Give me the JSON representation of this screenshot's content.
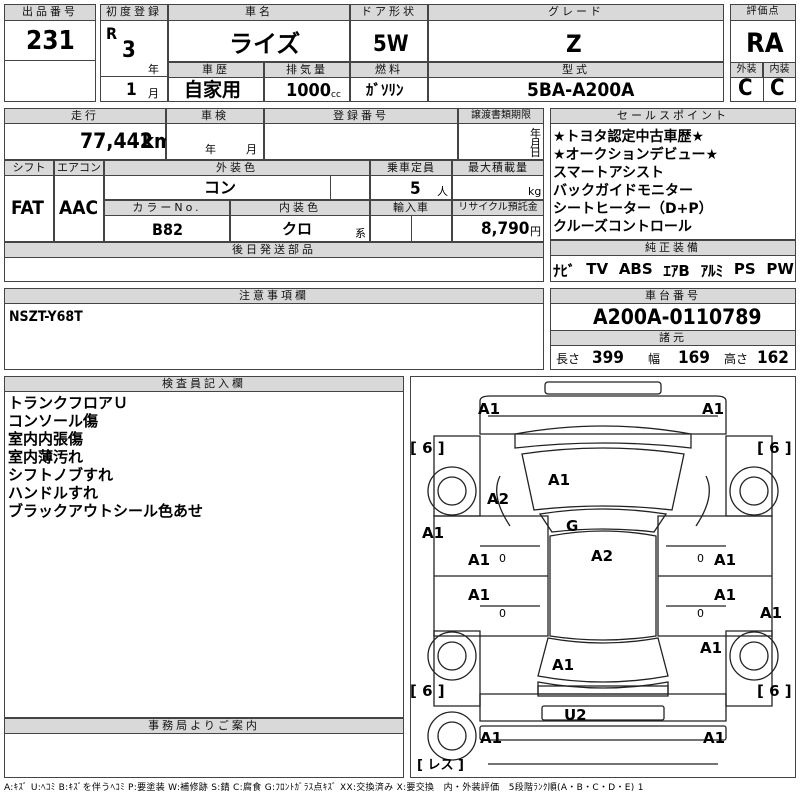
{
  "lot": {
    "header": "出品番号",
    "value": "231"
  },
  "registration": {
    "header": "初度登録",
    "era": "R",
    "year": "3",
    "year_unit": "年",
    "month": "1",
    "month_unit": "月"
  },
  "car_name": {
    "header": "車名",
    "value": "ライズ"
  },
  "door_type": {
    "header": "ドア形状",
    "value": "5W"
  },
  "grade": {
    "header": "グレード",
    "value": "Z"
  },
  "score": {
    "header": "評価点",
    "value": "RA",
    "exterior_header": "外装",
    "exterior_value": "C",
    "interior_header": "内装",
    "interior_value": "C"
  },
  "history": {
    "header": "車歴",
    "value": "自家用"
  },
  "displacement": {
    "header": "排気量",
    "value": "1000",
    "unit": "cc"
  },
  "fuel": {
    "header": "燃料",
    "value": "ｶﾞｿﾘﾝ"
  },
  "model_type": {
    "header": "型式",
    "value": "5BA-A200A"
  },
  "mileage": {
    "header": "走行",
    "value": "77,442",
    "unit": "km"
  },
  "inspection": {
    "header": "車検",
    "year_unit": "年",
    "month_unit": "月"
  },
  "reg_number": {
    "header": "登録番号"
  },
  "transfer_deadline": {
    "header": "譲渡書類期限",
    "year_unit": "年",
    "month_unit": "月",
    "day_unit": "日"
  },
  "selling_points": {
    "header": "セールスポイント",
    "items": [
      "★トヨタ認定中古車歴★",
      "★オークションデビュー★",
      "スマートアシスト",
      "バックガイドモニター",
      "シートヒーター（D+P）",
      "クルーズコントロール"
    ]
  },
  "shift": {
    "header": "シフト",
    "value": "FAT"
  },
  "aircon": {
    "header": "エアコン",
    "value": "AAC"
  },
  "exterior_color": {
    "header": "外装色",
    "value": "コン"
  },
  "capacity": {
    "header": "乗車定員",
    "value": "5",
    "unit": "人"
  },
  "max_load": {
    "header": "最大積載量",
    "unit": "kg"
  },
  "color_no": {
    "header": "カラーNo.",
    "value": "B82"
  },
  "interior_color": {
    "header": "内装色",
    "value": "クロ",
    "unit": "系"
  },
  "import": {
    "header": "輸入車"
  },
  "recycle": {
    "header": "リサイクル預託金",
    "value": "8,790",
    "unit": "円"
  },
  "later_parts": {
    "header": "後日発送部品"
  },
  "equipment": {
    "header": "純正装備",
    "items": [
      "ﾅﾋﾞ",
      "TV",
      "ABS",
      "ｴｱB",
      "ｱﾙﾐ",
      "PS",
      "PW"
    ]
  },
  "caution": {
    "header": "注意事項欄",
    "value": "NSZT-Y68T"
  },
  "chassis": {
    "header": "車台番号",
    "value": "A200A-0110789"
  },
  "dimensions": {
    "header": "諸元",
    "length_label": "長さ",
    "length": "399",
    "width_label": "幅",
    "width": "169",
    "height_label": "高さ",
    "height": "162"
  },
  "inspector_notes": {
    "header": "検査員記入欄",
    "lines": [
      "トランクフロアＵ",
      "コンソール傷",
      "室内内張傷",
      "室内薄汚れ",
      "シフトノブすれ",
      "ハンドルすれ",
      "ブラックアウトシール色あせ"
    ]
  },
  "office": {
    "header": "事務局よりご案内"
  },
  "diagram": {
    "front_left": "A1",
    "front_right": "A1",
    "tire_fl": "[ 6 ]",
    "tire_fr": "[ 6 ]",
    "tire_rl": "[ 6 ]",
    "tire_rr": "[ 6 ]",
    "hood": "A1",
    "left_fender": "A2",
    "windshield": "G",
    "left_panel": "A1",
    "left_front_door": "A1",
    "left_front_door_small": "0",
    "roof": "A2",
    "right_front_door": "A1",
    "right_front_door_small": "0",
    "left_rear_door": "A1",
    "left_rear_door_small": "0",
    "right_rear_door": "A1",
    "right_rear_door_small": "0",
    "right_panel": "A1",
    "right_rear_fender": "A1",
    "rear_glass": "A1",
    "bumper_rear": "U2",
    "rear_left": "A1",
    "rear_right": "A1",
    "spare": "[ レス ]"
  },
  "footer": "A:ｷｽﾞ U:ﾍｺﾐ B:ｷｽﾞを伴うﾍｺﾐ P:要塗装 W:補修跡 S:錆 C:腐食 G:ﾌﾛﾝﾄｶﾞﾗｽ点ｷｽﾞ XX:交換済み X:要交換　内・外装評価　5段階ﾗﾝｸ順(A・B・C・D・E) 1"
}
